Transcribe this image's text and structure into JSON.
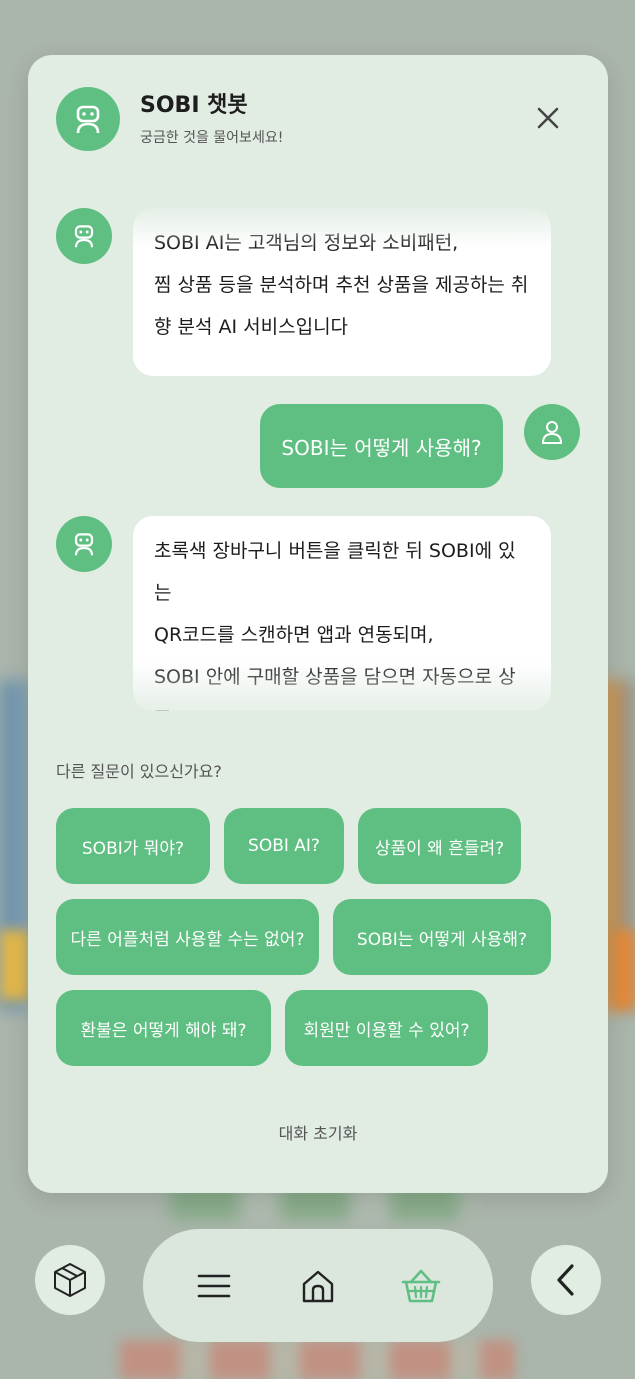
{
  "header": {
    "title": "SOBI 챗봇",
    "subtitle": "궁금한 것을 물어보세요!"
  },
  "messages": [
    {
      "role": "bot",
      "text": "SOBI AI는 고객님의 정보와 소비패턴,\n찜 상품 등을 분석하며 추천 상품을 제공하는 취\n향 분석 AI 서비스입니다"
    },
    {
      "role": "user",
      "text": "SOBI는 어떻게 사용해?"
    },
    {
      "role": "bot",
      "text": "초록색 장바구니 버튼을 클릭한 뒤 SOBI에 있는\nQR코드를 스캔하면 앱과 연동되며,\nSOBI 안에 구매할 상품을 담으면 자동으로 상품\n이 추가됩니다"
    }
  ],
  "suggestions": {
    "prompt": "다른 질문이 있으신가요?",
    "chips": [
      "SOBI가 뭐야?",
      "SOBI AI?",
      "상품이 왜 흔들려?",
      "다른 어플처럼 사용할 수는 없어?",
      "SOBI는 어떻게 사용해?",
      "환불은 어떻게 해야 돼?",
      "회원만 이용할 수 있어?"
    ]
  },
  "reset_label": "대화 초기화",
  "nav": {
    "left_icon": "box-icon",
    "center_icons": [
      "menu-icon",
      "home-icon",
      "basket-icon"
    ],
    "active": "basket-icon",
    "right_icon": "chevron-left-icon"
  },
  "colors": {
    "accent": "#5fbf82",
    "panel": "#e1ece3"
  }
}
